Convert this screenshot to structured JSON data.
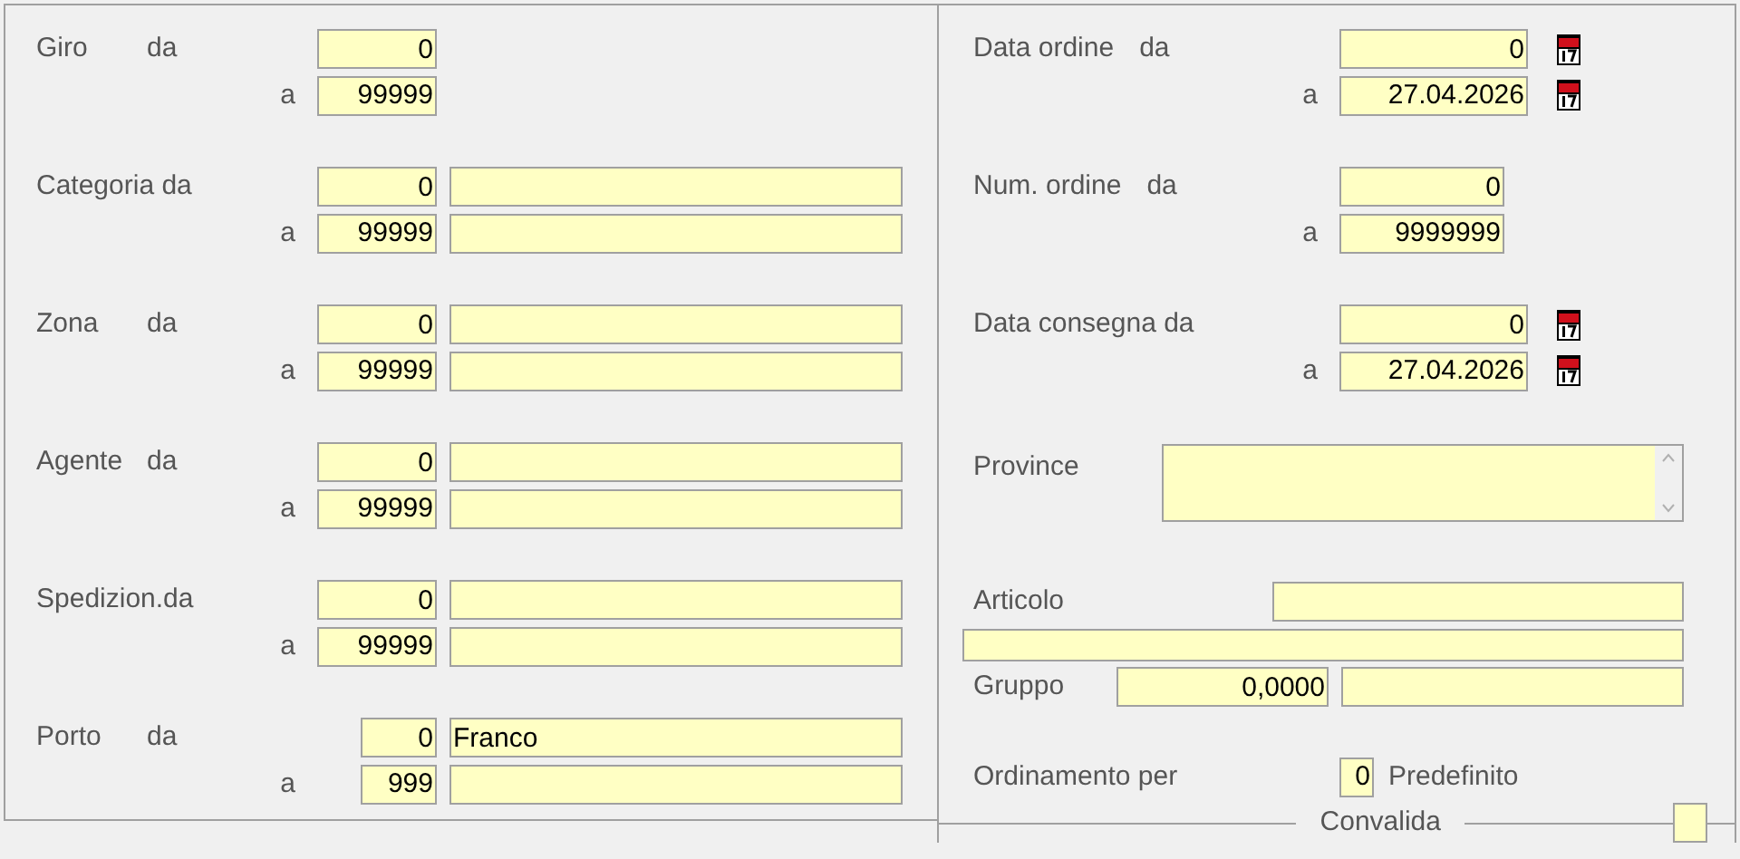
{
  "left_groups": [
    {
      "kind": "code",
      "label": "Giro",
      "from_label": "da",
      "to_label": "a",
      "from": {
        "code": "0"
      },
      "to": {
        "code": "99999"
      }
    },
    {
      "kind": "code_description",
      "label": "Categoria da",
      "to_label": "a",
      "from": {
        "code": "0"
      },
      "to": {
        "code": "99999"
      }
    },
    {
      "kind": "code_description",
      "label": "Zona",
      "from_label": "da",
      "to_label": "a",
      "from": {
        "code": "0"
      },
      "to": {
        "code": "99999"
      }
    },
    {
      "kind": "code_description",
      "label": "Agente",
      "from_label": "da",
      "to_label": "a",
      "from": {
        "code": "0"
      },
      "to": {
        "code": "99999"
      }
    },
    {
      "kind": "code_description",
      "label": "Spedizion.da",
      "to_label": "a",
      "from": {
        "code": "0"
      },
      "to": {
        "code": "99999"
      }
    },
    {
      "kind": "short_code_description",
      "label": "Porto",
      "from_label": "da",
      "to_label": "a",
      "from": {
        "code": "0",
        "description": "Franco"
      },
      "to": {
        "code": "999"
      }
    }
  ],
  "date_order": {
    "label": "Data ordine",
    "from_label": "da",
    "to_label": "a",
    "from": "0",
    "to": "27.04.2026"
  },
  "order_number": {
    "label": "Num. ordine",
    "from_label": "da",
    "to_label": "a",
    "from": "0",
    "to": "9999999"
  },
  "delivery_date": {
    "label": "Data consegna da",
    "to_label": "a",
    "from": "0",
    "to": "27.04.2026"
  },
  "province": {
    "label": "Province"
  },
  "articolo": {
    "label": "Articolo"
  },
  "gruppo": {
    "label": "Gruppo",
    "code": "0,0000"
  },
  "sort": {
    "label": "Ordinamento per",
    "code": "0",
    "description": "Predefinito"
  },
  "validate": {
    "label": "Convalida",
    "checked": false
  }
}
